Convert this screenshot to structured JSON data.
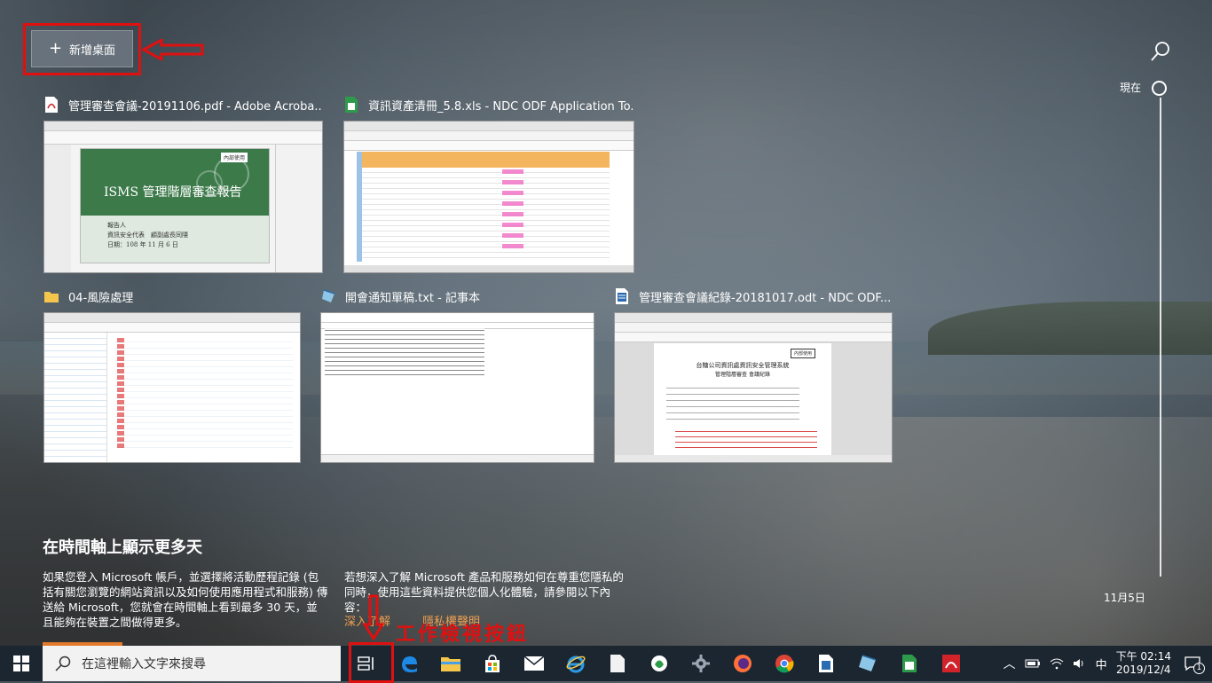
{
  "new_desktop": {
    "label": "新增桌面"
  },
  "windows": [
    {
      "title": "管理審查會議-20191106.pdf - Adobe Acroba...",
      "icon": "pdf-icon",
      "content": {
        "slide_title": "ISMS 管理階層審查報告",
        "stamp": "內部使用",
        "reporter": "報告人",
        "line1": "資訊安全代表　顧副處長同隱",
        "line2": "日期：108 年 11 月 6 日"
      }
    },
    {
      "title": "資訊資產清冊_5.8.xls - NDC ODF Application To...",
      "icon": "spreadsheet-icon"
    },
    {
      "title": "04-風險處理",
      "icon": "folder-icon"
    },
    {
      "title": "開會通知單稿.txt - 記事本",
      "icon": "notepad-icon"
    },
    {
      "title": "管理審查會議紀錄-20181017.odt - NDC ODF...",
      "icon": "document-icon",
      "content": {
        "heading": "台糖公司資訊處資訊安全管理系統",
        "sub": "管理階層審查 會議紀錄"
      }
    }
  ],
  "timeline": {
    "now": "現在",
    "date": "11月5日"
  },
  "promo": {
    "title": "在時間軸上顯示更多天",
    "left_text": "如果您登入 Microsoft 帳戶，並選擇將活動歷程記錄 (包括有關您瀏覽的網站資訊以及如何使用應用程式和服務) 傳送給 Microsoft，您就會在時間軸上看到最多 30 天，並且能夠在裝置之間做得更多。",
    "right_text": "若想深入了解 Microsoft 產品和服務如何在尊重您隱私的同時，使用這些資料提供您個人化體驗，請參閱以下內容：",
    "link1": "深入了解",
    "link2": "隱私權聲明"
  },
  "annotation": {
    "task_view_note": "工作檢視按鈕"
  },
  "taskbar": {
    "search_placeholder": "在這裡輸入文字來搜尋",
    "apps": [
      "edge-icon",
      "file-explorer-icon",
      "store-icon",
      "mail-icon",
      "ie-icon",
      "blank-file-icon",
      "green-app-icon",
      "gear-app-icon",
      "firefox-icon",
      "chrome-icon",
      "writer-icon",
      "notepad-icon",
      "calc-icon",
      "acrobat-icon"
    ],
    "ime": "中",
    "time": "下午 02:14",
    "date": "2019/12/4",
    "notification_count": "1"
  },
  "colors": {
    "annotation_red": "#e01010",
    "taskbar": "#1c2630",
    "link_orange": "#f0a050"
  }
}
